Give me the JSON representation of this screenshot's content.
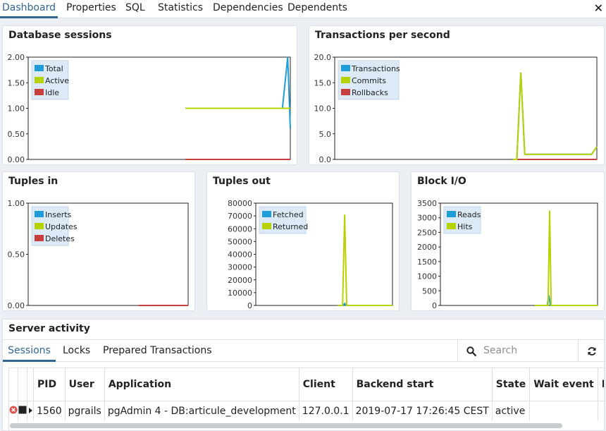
{
  "tabs": [
    "Dashboard",
    "Properties",
    "SQL",
    "Statistics",
    "Dependencies",
    "Dependents"
  ],
  "colors": {
    "blue": "#1e9dd8",
    "green": "#b6d300",
    "red": "#c8403e",
    "accent": "#326690"
  },
  "charts": {
    "sessions": {
      "title": "Database sessions",
      "yticks": [
        "2.00",
        "1.50",
        "1.00",
        "0.50",
        "0.00"
      ],
      "ylim": [
        0,
        2
      ],
      "legend": [
        "Total",
        "Active",
        "Idle"
      ],
      "series": [
        {
          "name": "Total",
          "color": "#1e9dd8",
          "points": [
            [
              0.6,
              1
            ],
            [
              0.97,
              1
            ],
            [
              0.99,
              2
            ],
            [
              1.0,
              0.6
            ]
          ]
        },
        {
          "name": "Active",
          "color": "#b6d300",
          "points": [
            [
              0.6,
              1
            ],
            [
              1.0,
              1
            ]
          ]
        },
        {
          "name": "Idle",
          "color": "#c8403e",
          "points": [
            [
              0.6,
              0
            ],
            [
              1.0,
              0
            ]
          ]
        }
      ]
    },
    "transactions": {
      "title": "Transactions per second",
      "yticks": [
        "20.0",
        "15.0",
        "10.0",
        "5.0",
        "0.0"
      ],
      "ylim": [
        0,
        20
      ],
      "legend": [
        "Transactions",
        "Commits",
        "Rollbacks"
      ],
      "series": [
        {
          "name": "Rollbacks",
          "color": "#c8403e",
          "points": [
            [
              0.68,
              0
            ],
            [
              1.0,
              0
            ]
          ]
        },
        {
          "name": "Transactions",
          "color": "#1e9dd8",
          "points": [
            [
              0.68,
              0
            ],
            [
              0.695,
              0
            ],
            [
              0.71,
              17
            ],
            [
              0.725,
              1
            ],
            [
              0.98,
              1
            ],
            [
              1.0,
              2.5
            ]
          ]
        },
        {
          "name": "Commits",
          "color": "#b6d300",
          "points": [
            [
              0.68,
              0
            ],
            [
              0.695,
              0
            ],
            [
              0.71,
              17
            ],
            [
              0.725,
              1
            ],
            [
              0.98,
              1
            ],
            [
              1.0,
              2.5
            ]
          ]
        }
      ]
    },
    "tuples_in": {
      "title": "Tuples in",
      "yticks": [
        "1.00",
        "0.50",
        "0.00"
      ],
      "ylim": [
        0,
        1
      ],
      "legend": [
        "Inserts",
        "Updates",
        "Deletes"
      ],
      "series": [
        {
          "name": "Inserts",
          "color": "#1e9dd8",
          "points": [
            [
              0.69,
              0
            ],
            [
              1.0,
              0
            ]
          ]
        },
        {
          "name": "Updates",
          "color": "#b6d300",
          "points": [
            [
              0.69,
              0
            ],
            [
              1.0,
              0
            ]
          ]
        },
        {
          "name": "Deletes",
          "color": "#c8403e",
          "points": [
            [
              0.69,
              0
            ],
            [
              1.0,
              0
            ]
          ]
        }
      ]
    },
    "tuples_out": {
      "title": "Tuples out",
      "yticks": [
        "80000",
        "70000",
        "60000",
        "50000",
        "40000",
        "30000",
        "20000",
        "10000",
        "0"
      ],
      "ylim": [
        0,
        80000
      ],
      "legend": [
        "Fetched",
        "Returned"
      ],
      "series": [
        {
          "name": "Fetched",
          "color": "#1e9dd8",
          "points": [
            [
              0.6,
              0
            ],
            [
              0.64,
              0
            ],
            [
              0.65,
              1500
            ],
            [
              0.66,
              0
            ],
            [
              1.0,
              0
            ]
          ]
        },
        {
          "name": "Returned",
          "color": "#b6d300",
          "points": [
            [
              0.6,
              0
            ],
            [
              0.635,
              0
            ],
            [
              0.65,
              71000
            ],
            [
              0.665,
              0
            ],
            [
              1.0,
              0
            ]
          ]
        }
      ]
    },
    "block_io": {
      "title": "Block I/O",
      "yticks": [
        "3500",
        "3000",
        "2500",
        "2000",
        "1500",
        "1000",
        "500",
        "0"
      ],
      "ylim": [
        0,
        3500
      ],
      "legend": [
        "Reads",
        "Hits"
      ],
      "series": [
        {
          "name": "Reads",
          "color": "#1e9dd8",
          "points": [
            [
              0.6,
              0
            ],
            [
              0.68,
              0
            ],
            [
              0.69,
              350
            ],
            [
              0.7,
              0
            ],
            [
              1.0,
              0
            ]
          ]
        },
        {
          "name": "Hits",
          "color": "#b6d300",
          "points": [
            [
              0.6,
              0
            ],
            [
              0.685,
              0
            ],
            [
              0.695,
              3250
            ],
            [
              0.705,
              0
            ],
            [
              1.0,
              0
            ]
          ]
        }
      ]
    }
  },
  "server_activity": {
    "title": "Server activity",
    "tabs": [
      "Sessions",
      "Locks",
      "Prepared Transactions"
    ],
    "search_placeholder": "Search",
    "columns": [
      "PID",
      "User",
      "Application",
      "Client",
      "Backend start",
      "State",
      "Wait event",
      "Blocking PIDs"
    ],
    "rows": [
      {
        "pid": "1560",
        "user": "pgrails",
        "application": "pgAdmin 4 - DB:articule_development",
        "client": "127.0.0.1",
        "backend_start": "2019-07-17 17:26:45 CEST",
        "state": "active",
        "wait_event": "",
        "blocking": ""
      }
    ]
  }
}
